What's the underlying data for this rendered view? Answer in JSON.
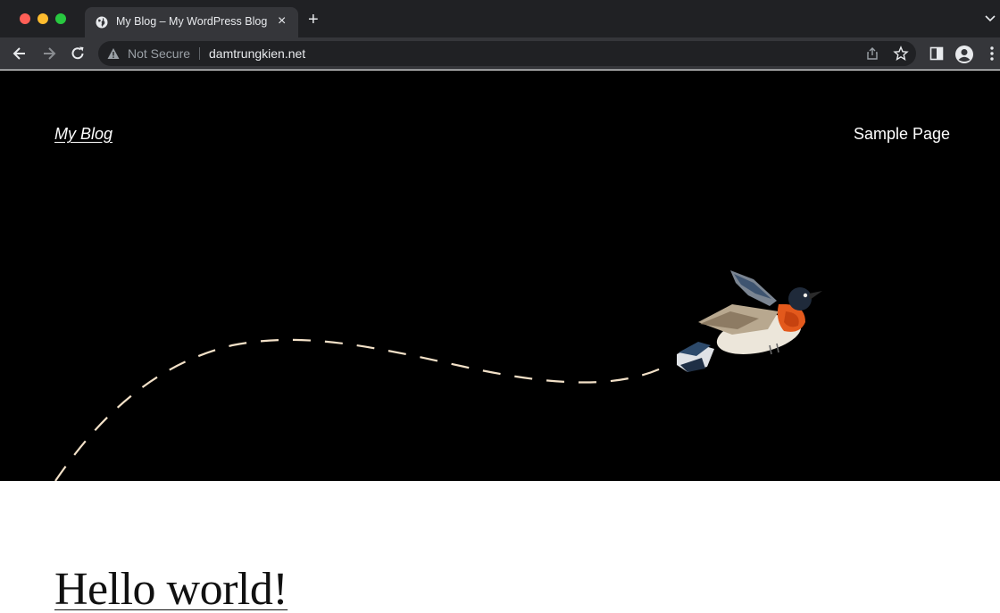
{
  "browser": {
    "tab": {
      "title": "My Blog – My WordPress Blog"
    },
    "new_tab_label": "+",
    "close_label": "×",
    "address": {
      "security_label": "Not Secure",
      "url": "damtrungkien.net"
    }
  },
  "site": {
    "title": "My Blog",
    "nav": [
      {
        "label": "Sample Page"
      }
    ]
  },
  "post": {
    "title": "Hello world!"
  },
  "colors": {
    "tabstrip": "#202124",
    "toolbar": "#35363a",
    "hero_bg": "#000000",
    "flight_path": "#f3e1c8"
  }
}
